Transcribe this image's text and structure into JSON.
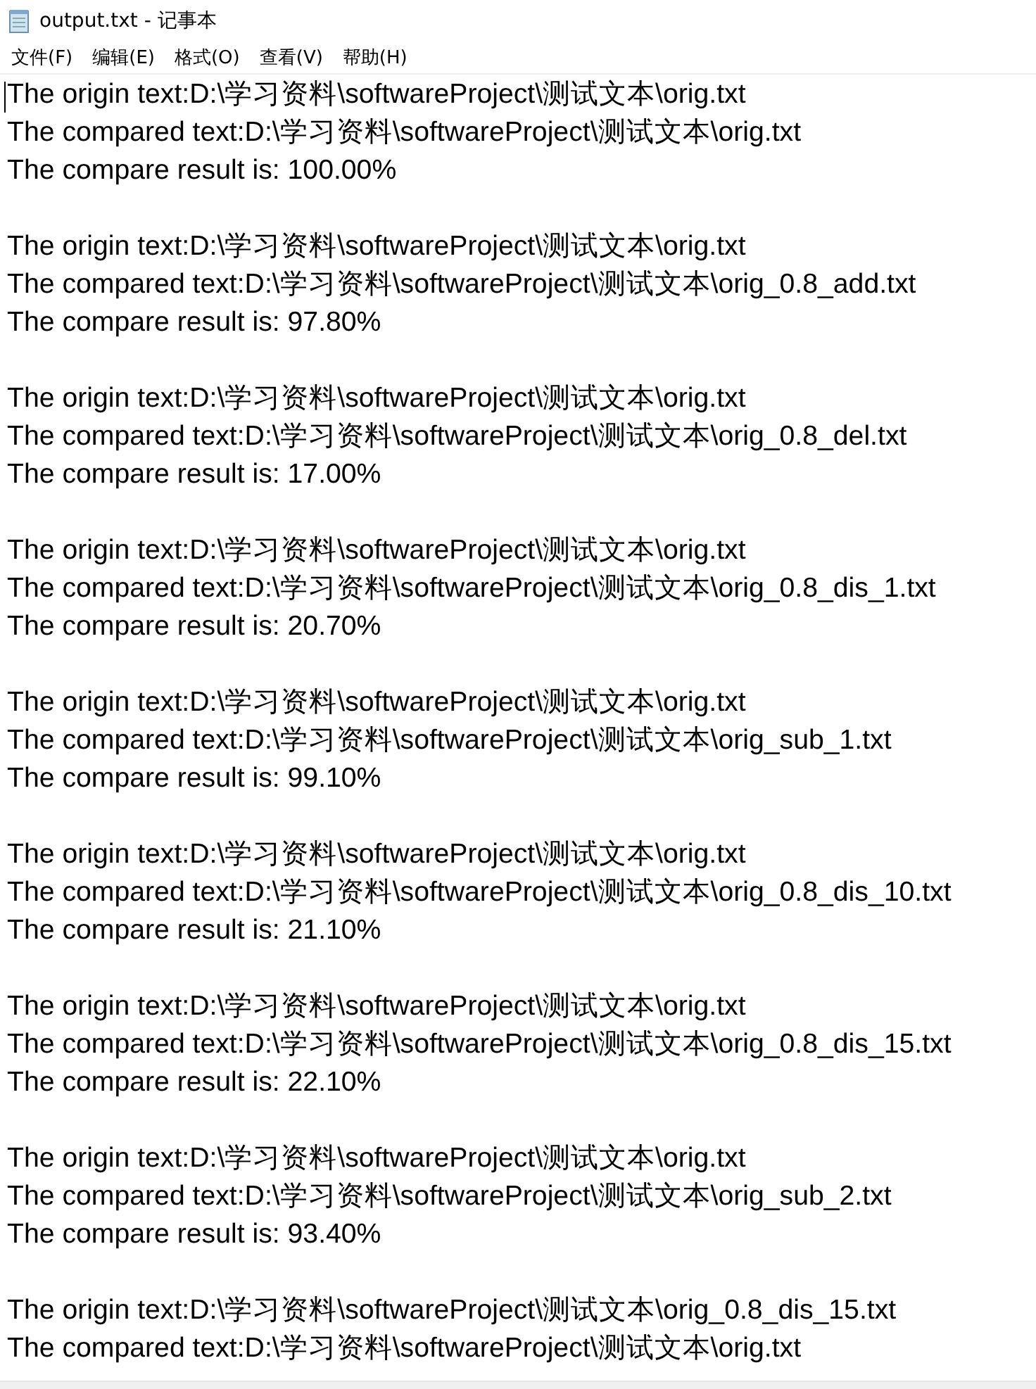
{
  "window": {
    "title": "output.txt - 记事本"
  },
  "menu": [
    {
      "label": "文件(F)"
    },
    {
      "label": "编辑(E)"
    },
    {
      "label": "格式(O)"
    },
    {
      "label": "查看(V)"
    },
    {
      "label": "帮助(H)"
    }
  ],
  "document": {
    "groups": [
      {
        "lines": [
          "The origin text:D:\\学习资料\\softwareProject\\测试文本\\orig.txt",
          "The compared text:D:\\学习资料\\softwareProject\\测试文本\\orig.txt",
          "The compare result is: 100.00%"
        ]
      },
      {
        "lines": [
          "The origin text:D:\\学习资料\\softwareProject\\测试文本\\orig.txt",
          "The compared text:D:\\学习资料\\softwareProject\\测试文本\\orig_0.8_add.txt",
          "The compare result is: 97.80%"
        ]
      },
      {
        "lines": [
          "The origin text:D:\\学习资料\\softwareProject\\测试文本\\orig.txt",
          "The compared text:D:\\学习资料\\softwareProject\\测试文本\\orig_0.8_del.txt",
          "The compare result is: 17.00%"
        ]
      },
      {
        "lines": [
          "The origin text:D:\\学习资料\\softwareProject\\测试文本\\orig.txt",
          "The compared text:D:\\学习资料\\softwareProject\\测试文本\\orig_0.8_dis_1.txt",
          "The compare result is: 20.70%"
        ]
      },
      {
        "lines": [
          "The origin text:D:\\学习资料\\softwareProject\\测试文本\\orig.txt",
          "The compared text:D:\\学习资料\\softwareProject\\测试文本\\orig_sub_1.txt",
          "The compare result is: 99.10%"
        ]
      },
      {
        "lines": [
          "The origin text:D:\\学习资料\\softwareProject\\测试文本\\orig.txt",
          "The compared text:D:\\学习资料\\softwareProject\\测试文本\\orig_0.8_dis_10.txt",
          "The compare result is: 21.10%"
        ]
      },
      {
        "lines": [
          "The origin text:D:\\学习资料\\softwareProject\\测试文本\\orig.txt",
          "The compared text:D:\\学习资料\\softwareProject\\测试文本\\orig_0.8_dis_15.txt",
          "The compare result is: 22.10%"
        ]
      },
      {
        "lines": [
          "The origin text:D:\\学习资料\\softwareProject\\测试文本\\orig.txt",
          "The compared text:D:\\学习资料\\softwareProject\\测试文本\\orig_sub_2.txt",
          "The compare result is: 93.40%"
        ]
      },
      {
        "lines": [
          "The origin text:D:\\学习资料\\softwareProject\\测试文本\\orig_0.8_dis_15.txt",
          "The compared text:D:\\学习资料\\softwareProject\\测试文本\\orig.txt"
        ]
      }
    ]
  }
}
